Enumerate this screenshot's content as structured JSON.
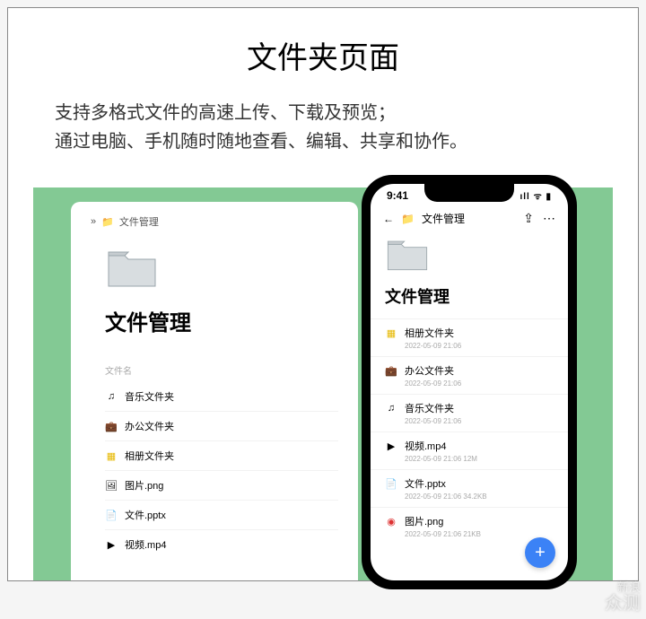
{
  "hero": {
    "title": "文件夹页面",
    "line1": "支持多格式文件的高速上传、下载及预览；",
    "line2": "通过电脑、手机随时随地查看、编辑、共享和协作。"
  },
  "desktop": {
    "breadcrumb_icon": "»",
    "breadcrumb": "文件管理",
    "heading": "文件管理",
    "col_header": "文件名",
    "items": [
      {
        "icon": "music",
        "name": "音乐文件夹"
      },
      {
        "icon": "office",
        "name": "办公文件夹"
      },
      {
        "icon": "album",
        "name": "相册文件夹"
      },
      {
        "icon": "image",
        "name": "图片.png"
      },
      {
        "icon": "file",
        "name": "文件.pptx"
      },
      {
        "icon": "video",
        "name": "视频.mp4"
      }
    ]
  },
  "phone": {
    "time": "9:41",
    "back_glyph": "←",
    "breadcrumb": "文件管理",
    "share_glyph": "⇪",
    "more_glyph": "⋯",
    "heading": "文件管理",
    "items": [
      {
        "icon": "album",
        "name": "相册文件夹",
        "meta": "2022-05-09 21:06"
      },
      {
        "icon": "office",
        "name": "办公文件夹",
        "meta": "2022-05-09 21:06"
      },
      {
        "icon": "music",
        "name": "音乐文件夹",
        "meta": "2022-05-09 21:06"
      },
      {
        "icon": "video",
        "name": "视频.mp4",
        "meta": "2022-05-09 21:06   12M"
      },
      {
        "icon": "file",
        "name": "文件.pptx",
        "meta": "2022-05-09 21:06   34.2KB"
      },
      {
        "icon": "image",
        "name": "图片.png",
        "meta": "2022-05-09 21:06   21KB"
      }
    ],
    "fab_glyph": "+"
  },
  "watermark": {
    "line1": "新浪",
    "line2": "众测"
  }
}
